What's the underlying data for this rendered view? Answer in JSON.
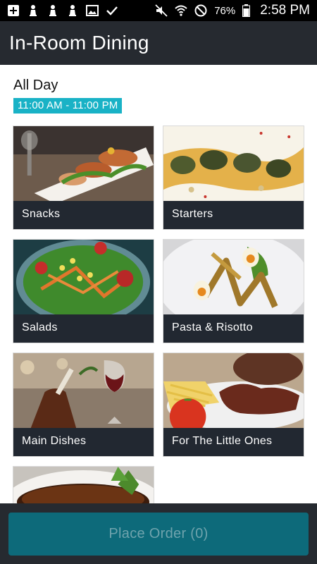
{
  "status_bar": {
    "left_icons": [
      "add-icon",
      "chess-pawn-icon",
      "chess-pawn-icon",
      "chess-pawn-icon",
      "image-icon",
      "check-icon"
    ],
    "right_icons": [
      "mute-icon",
      "wifi-icon",
      "do-not-disturb-icon",
      "battery-icon"
    ],
    "battery_percent": "76%",
    "time": "2:58 PM"
  },
  "app_bar": {
    "title": "In-Room Dining"
  },
  "menu": {
    "name": "All Day",
    "hours": "11:00 AM - 11:00 PM"
  },
  "categories": [
    {
      "label": "Snacks",
      "image": "snacks-photo"
    },
    {
      "label": "Starters",
      "image": "starters-photo"
    },
    {
      "label": "Salads",
      "image": "salads-photo"
    },
    {
      "label": "Pasta & Risotto",
      "image": "pasta-photo"
    },
    {
      "label": "Main Dishes",
      "image": "main-dishes-photo"
    },
    {
      "label": "For The Little Ones",
      "image": "little-ones-photo"
    },
    {
      "label": "",
      "image": "dessert-photo"
    }
  ],
  "order_button": {
    "label": "Place Order (0)"
  },
  "colors": {
    "app_bar": "#262a30",
    "accent": "#19b2c6",
    "button": "#0d6a7a",
    "card_footer": "#222831"
  }
}
